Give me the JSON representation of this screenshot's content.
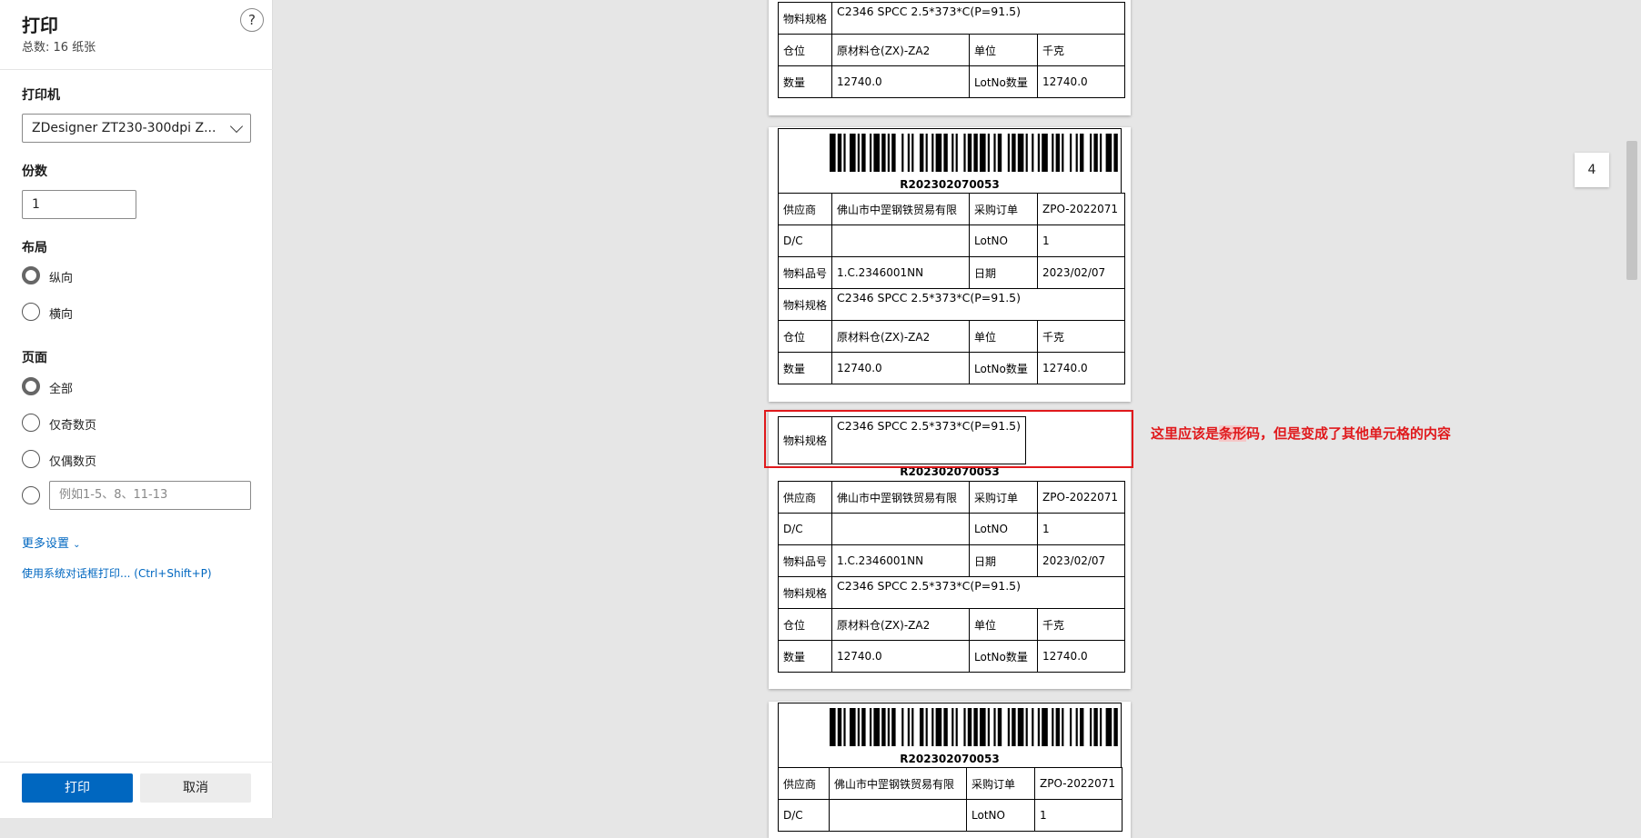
{
  "dialog": {
    "title": "打印",
    "subtitle": "总数: 16 纸张",
    "help_icon": "?",
    "printer_label": "打印机",
    "printer_value": "ZDesigner ZT230-300dpi Z...",
    "copies_label": "份数",
    "copies_value": "1",
    "layout_label": "布局",
    "layout_options": [
      "纵向",
      "横向"
    ],
    "pages_label": "页面",
    "pages_options": [
      "全部",
      "仅奇数页",
      "仅偶数页"
    ],
    "range_placeholder": "例如1-5、8、11-13",
    "more_settings": "更多设置",
    "system_dialog": "使用系统对话框打印... (Ctrl+Shift+P)",
    "print_button": "打印",
    "cancel_button": "取消"
  },
  "label": {
    "barcode": "R202302070053",
    "supplier_label": "供应商",
    "supplier_value": "佛山市中罡钢铁贸易有限",
    "po_label": "采购订单",
    "po_value": "ZPO-2022071",
    "dc_label": "D/C",
    "dc_value": "",
    "lotno_label": "LotNO",
    "lotno_value": "1",
    "part_label": "物料品号",
    "part_value": "1.C.2346001NN",
    "date_label": "日期",
    "date_value": "2023/02/07",
    "spec_label": "物料规格",
    "spec_value": "C2346 SPCC 2.5*373*C(P=91.5)",
    "warehouse_label": "仓位",
    "warehouse_value": "原材料仓(ZX)-ZA2",
    "unit_label": "单位",
    "unit_value": "千克",
    "qty_label": "数量",
    "qty_value": "12740.0",
    "lotqty_label": "LotNo数量",
    "lotqty_value": "12740.0"
  },
  "annotation": {
    "text_pre": "这里应该是",
    "text_hl": "条形",
    "text_post": "码，但是变成了其他单元格的内容",
    "color": "#e0191c"
  },
  "page_indicator": "4"
}
